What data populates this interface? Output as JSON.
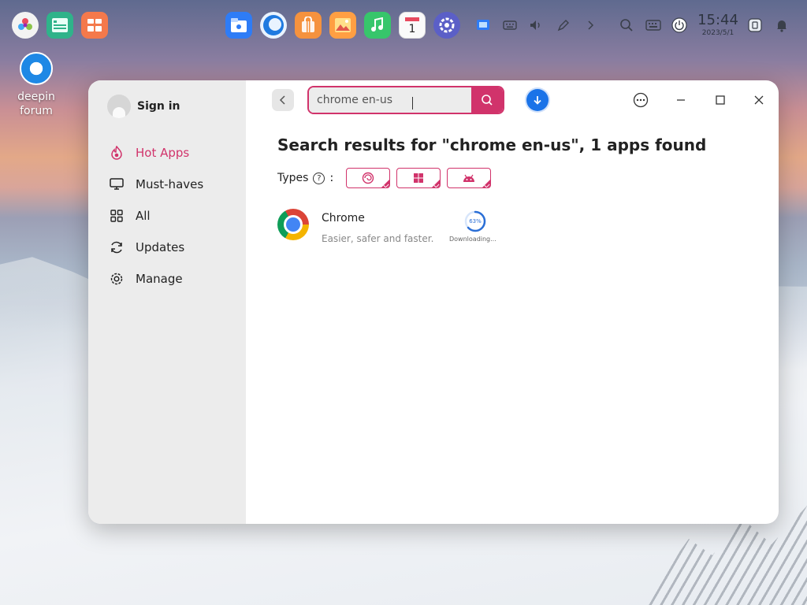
{
  "desktop": {
    "icon_label": "deepin forum"
  },
  "dock": {
    "clock_time": "15:44",
    "clock_date": "2023/5/1"
  },
  "sidebar": {
    "signin_label": "Sign in",
    "items": [
      {
        "label": "Hot Apps",
        "icon": "flame-icon",
        "active": true
      },
      {
        "label": "Must-haves",
        "icon": "monitor-icon",
        "active": false
      },
      {
        "label": "All",
        "icon": "grid-icon",
        "active": false
      },
      {
        "label": "Updates",
        "icon": "refresh-icon",
        "active": false
      },
      {
        "label": "Manage",
        "icon": "gear-icon",
        "active": false
      }
    ]
  },
  "search": {
    "value": "chrome en-us"
  },
  "results": {
    "title": "Search results for \"chrome en-us\", 1 apps found",
    "types_label": "Types",
    "types_colon": ":",
    "help": "?",
    "type_filters": [
      "deepin",
      "windows",
      "android"
    ]
  },
  "apps": [
    {
      "name": "Chrome",
      "description": "Easier, safer and faster.",
      "progress_percent": 63,
      "progress_text": "63%",
      "status": "Downloading..."
    }
  ],
  "colors": {
    "accent": "#d1336b",
    "download_blue": "#1a73e8"
  }
}
